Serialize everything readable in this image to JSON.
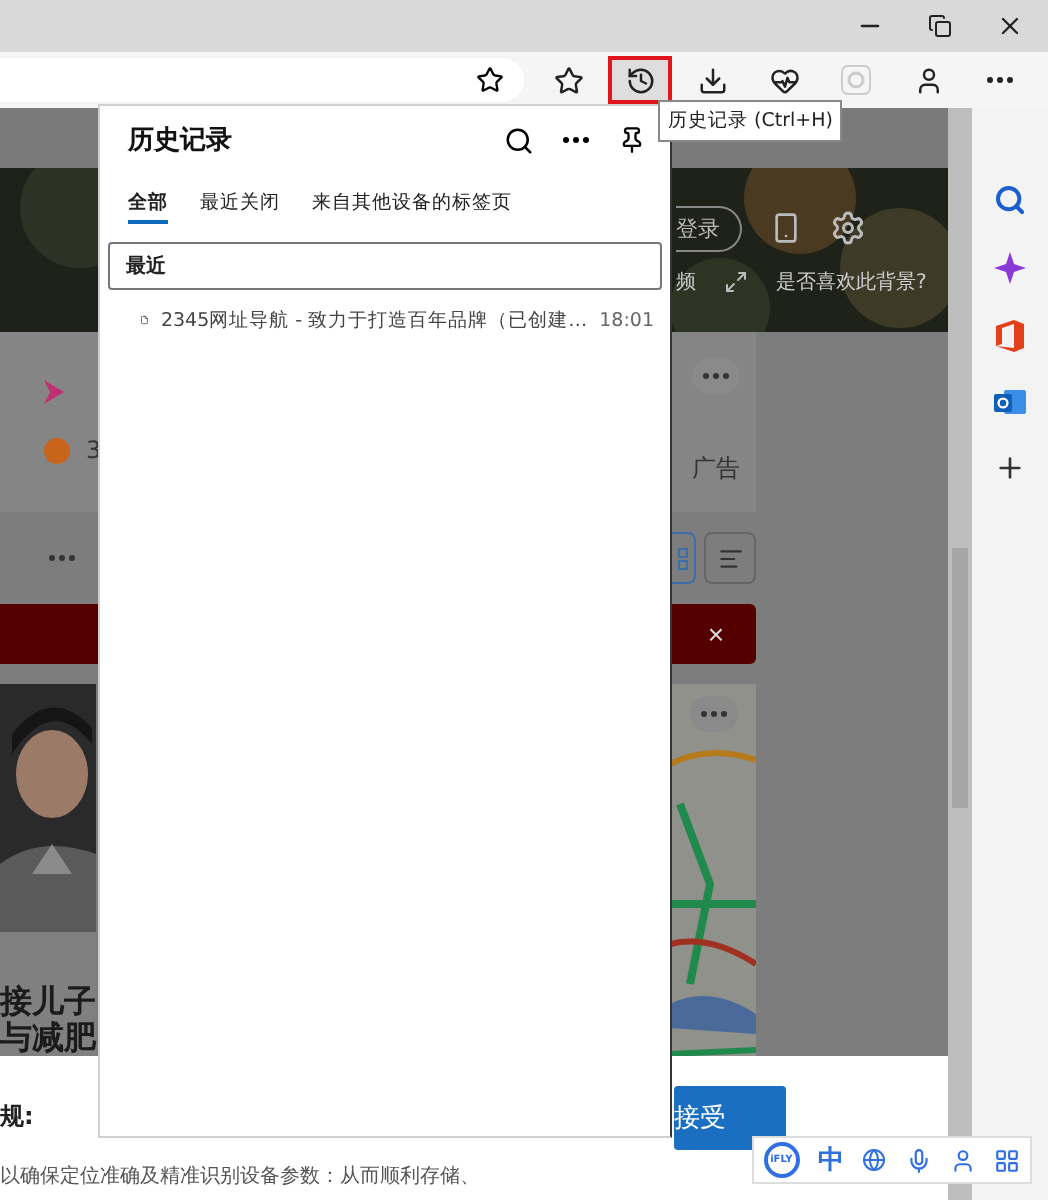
{
  "toolbar": {
    "buttons": [
      {
        "kind": "favorites",
        "selected": false
      },
      {
        "kind": "history",
        "selected": true
      },
      {
        "kind": "downloads",
        "selected": false
      },
      {
        "kind": "health",
        "selected": false
      },
      {
        "kind": "ie",
        "selected": false
      },
      {
        "kind": "profile",
        "selected": false
      },
      {
        "kind": "more",
        "selected": false
      }
    ]
  },
  "tooltip": "历史记录 (Ctrl+H)",
  "history_panel": {
    "title": "历史记录",
    "tabs": [
      {
        "label": "全部",
        "selected": true
      },
      {
        "label": "最近关闭",
        "selected": false
      },
      {
        "label": "来自其他设备的标签页",
        "selected": false
      }
    ],
    "group": "最近",
    "items": [
      {
        "title": "2345网址导航 - 致力于打造百年品牌（已创建…",
        "time": "18:01"
      }
    ]
  },
  "page": {
    "hero": {
      "signin": "登录",
      "caption_1": "频",
      "caption_2": "是否喜欢此背景?"
    },
    "list_prefix": "3",
    "ad_label": "广告",
    "banner_close": "×",
    "news": {
      "headline": [
        "接儿子",
        "与减肥"
      ]
    },
    "consent": {
      "heading": "规:",
      "text": "以确保定位准确及精准识别设备参数：从而顺利存储、",
      "accept": "接受"
    }
  },
  "ime": {
    "logo": "iFLY",
    "mode": "中"
  }
}
